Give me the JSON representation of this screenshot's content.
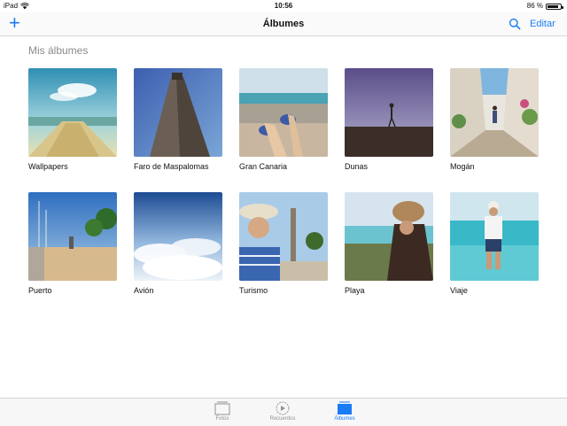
{
  "status_bar": {
    "device": "iPad",
    "time": "10:56",
    "battery": "86 %",
    "battery_level": 0.86
  },
  "nav": {
    "add_label": "+",
    "title": "Álbumes",
    "edit_label": "Editar",
    "search_icon": "search-icon"
  },
  "section": {
    "title": "Mis álbumes"
  },
  "albums": [
    {
      "name": "Wallpapers"
    },
    {
      "name": "Faro de Maspalomas"
    },
    {
      "name": "Gran Canaria"
    },
    {
      "name": "Dunas"
    },
    {
      "name": "Mogán"
    },
    {
      "name": "Puerto"
    },
    {
      "name": "Avión"
    },
    {
      "name": "Turismo"
    },
    {
      "name": "Playa"
    },
    {
      "name": "Viaje"
    }
  ],
  "tabbar": {
    "tabs": [
      {
        "label": "Fotos",
        "icon": "photos-icon",
        "active": false
      },
      {
        "label": "Recuerdos",
        "icon": "memories-icon",
        "active": false
      },
      {
        "label": "Álbumes",
        "icon": "albums-icon",
        "active": true
      }
    ]
  },
  "colors": {
    "accent": "#1a7cf5",
    "section_title": "#8a8a8f"
  }
}
